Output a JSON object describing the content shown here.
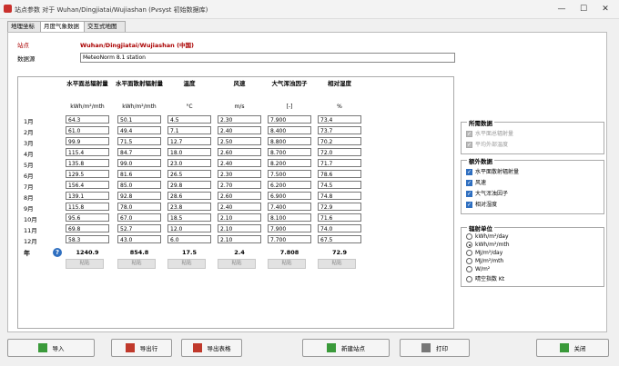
{
  "window": {
    "title": "站点参数 对于 Wuhan/Dingjiatai/Wujiashan (Pvsyst 初始数据库)"
  },
  "tabs": [
    {
      "label": "地理坐标"
    },
    {
      "label": "月度气象数据"
    },
    {
      "label": "交互式地图"
    }
  ],
  "site": {
    "label": "站点",
    "value": "Wuhan/Dingjiatai/Wujiashan  (中国)"
  },
  "dataset": {
    "label": "数据源",
    "value": "MeteoNorm 8.1 station"
  },
  "table": {
    "columns": [
      {
        "header": "水平面总辐射量",
        "unit": "kWh/m²/mth"
      },
      {
        "header": "水平面散射辐射量",
        "unit": "kWh/m²/mth"
      },
      {
        "header": "温度",
        "unit": "°C"
      },
      {
        "header": "风速",
        "unit": "m/s"
      },
      {
        "header": "大气浑浊因子",
        "unit": "[-]"
      },
      {
        "header": "相对湿度",
        "unit": "%"
      }
    ],
    "months": [
      "1月",
      "2月",
      "3月",
      "4月",
      "5月",
      "6月",
      "7月",
      "8月",
      "9月",
      "10月",
      "11月",
      "12月"
    ],
    "rows": [
      [
        "64.3",
        "50.1",
        "4.5",
        "2.30",
        "7.900",
        "73.4"
      ],
      [
        "61.0",
        "49.4",
        "7.1",
        "2.40",
        "8.400",
        "73.7"
      ],
      [
        "99.9",
        "71.5",
        "12.7",
        "2.50",
        "8.800",
        "70.2"
      ],
      [
        "115.4",
        "84.7",
        "18.0",
        "2.60",
        "8.700",
        "72.0"
      ],
      [
        "135.8",
        "99.0",
        "23.0",
        "2.40",
        "8.200",
        "71.7"
      ],
      [
        "129.5",
        "81.6",
        "26.5",
        "2.30",
        "7.500",
        "78.6"
      ],
      [
        "156.4",
        "85.0",
        "29.8",
        "2.70",
        "6.200",
        "74.5"
      ],
      [
        "139.1",
        "92.8",
        "28.6",
        "2.60",
        "6.900",
        "74.8"
      ],
      [
        "115.8",
        "78.0",
        "23.8",
        "2.40",
        "7.400",
        "72.9"
      ],
      [
        "95.6",
        "67.0",
        "18.5",
        "2.10",
        "8.100",
        "71.6"
      ],
      [
        "69.8",
        "52.7",
        "12.0",
        "2.10",
        "7.900",
        "74.0"
      ],
      [
        "58.3",
        "43.0",
        "6.0",
        "2.10",
        "7.700",
        "67.5"
      ]
    ],
    "year_label": "年",
    "totals": [
      "1240.9",
      "854.8",
      "17.5",
      "2.4",
      "7.808",
      "72.9"
    ],
    "paste_label": "粘贴"
  },
  "required_data": {
    "title": "所需数据",
    "items": [
      {
        "label": "水平面总辐射量",
        "checked": true
      },
      {
        "label": "平均外部温度",
        "checked": true
      }
    ]
  },
  "extra_data": {
    "title": "额外数据",
    "items": [
      {
        "label": "水平面散射辐射量",
        "checked": true
      },
      {
        "label": "风速",
        "checked": true
      },
      {
        "label": "大气浑浊因子",
        "checked": true
      },
      {
        "label": "相对湿度",
        "checked": true
      }
    ]
  },
  "irradiation_units": {
    "title": "辐射单位",
    "options": [
      {
        "label": "kWh/m²/day",
        "selected": false
      },
      {
        "label": "kWh/m²/mth",
        "selected": true
      },
      {
        "label": "MJ/m²/day",
        "selected": false
      },
      {
        "label": "MJ/m²/mth",
        "selected": false
      },
      {
        "label": "W/m²",
        "selected": false
      },
      {
        "label": "晴空指数 Kt",
        "selected": false
      }
    ]
  },
  "buttons": {
    "import": "导入",
    "export_row": "导出行",
    "export_table": "导出表格",
    "new_site": "新建站点",
    "print": "打印",
    "close": "关闭"
  }
}
